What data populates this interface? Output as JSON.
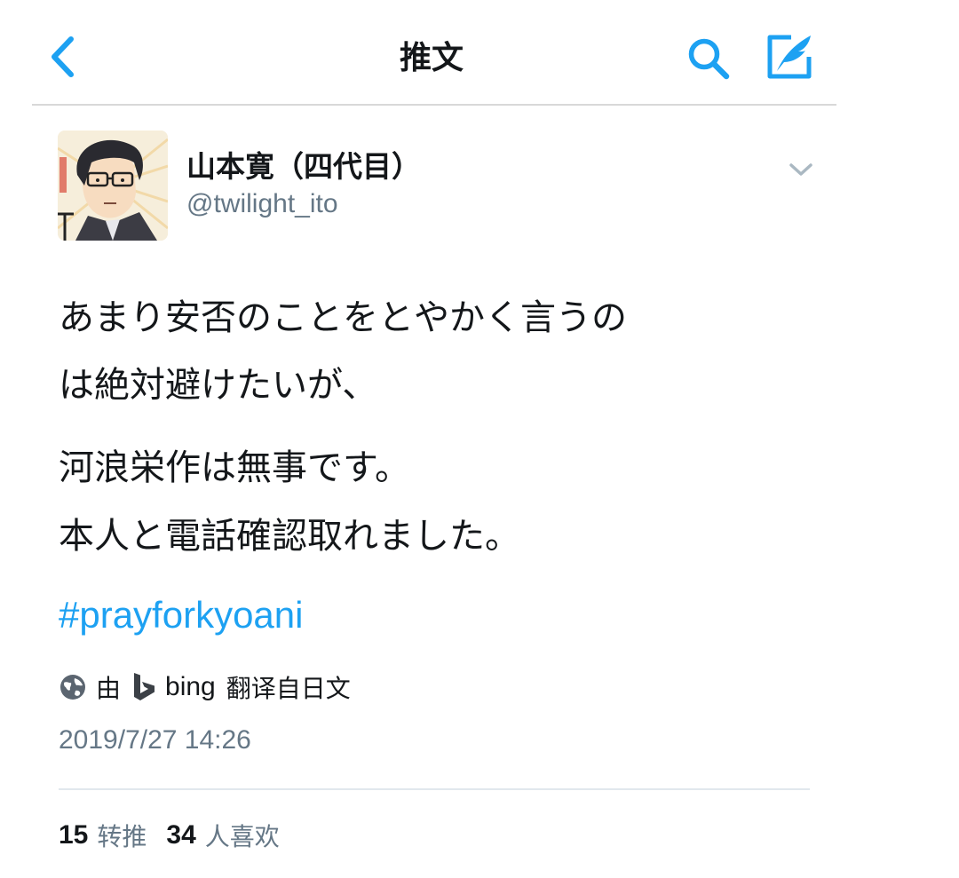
{
  "header": {
    "title": "推文",
    "back_icon": "chevron-left-icon",
    "search_icon": "search-icon",
    "compose_icon": "compose-feather-icon"
  },
  "author": {
    "display_name": "山本寛（四代目）",
    "handle": "@twilight_ito",
    "avatar_icon": "avatar-illustration",
    "more_icon": "chevron-down-icon"
  },
  "tweet": {
    "lines": [
      "あまり安否のことをとやかく言うの",
      "は絶対避けたいが、",
      "河浪栄作は無事です。",
      "本人と電話確認取れました。"
    ],
    "hashtag": "#prayforkyoani",
    "translation": {
      "by": "由",
      "provider": "bing",
      "from_language": "翻译自日文",
      "globe_icon": "globe-icon",
      "logo_icon": "bing-logo-icon"
    },
    "timestamp": "2019/7/27 14:26"
  },
  "stats": {
    "retweets": "15",
    "retweets_label": "转推",
    "likes": "34",
    "likes_label": "人喜欢"
  },
  "colors": {
    "accent": "#1da1f2",
    "text": "#14171a",
    "secondary": "#657786",
    "divider": "#e1e8ed"
  }
}
